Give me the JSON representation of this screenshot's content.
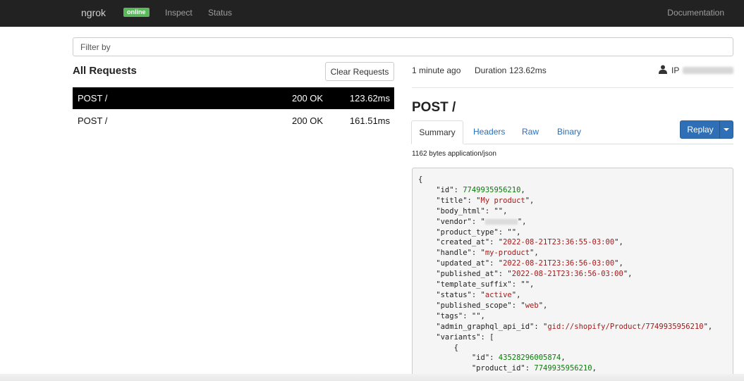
{
  "nav": {
    "brand": "ngrok",
    "badge": "online",
    "inspect": "Inspect",
    "status": "Status",
    "docs": "Documentation"
  },
  "filter": {
    "placeholder": "Filter by"
  },
  "requests": {
    "title": "All Requests",
    "clear_label": "Clear Requests",
    "rows": [
      {
        "method": "POST /",
        "status": "200 OK",
        "duration": "123.62ms",
        "selected": true
      },
      {
        "method": "POST /",
        "status": "200 OK",
        "duration": "161.51ms",
        "selected": false
      }
    ]
  },
  "detail": {
    "time": "1 minute ago",
    "duration_label": "Duration",
    "duration": "123.62ms",
    "ip_label": "IP",
    "title": "POST /",
    "tabs": [
      "Summary",
      "Headers",
      "Raw",
      "Binary"
    ],
    "replay_label": "Replay",
    "size_info": "1162 bytes application/json",
    "json_body": {
      "id": "7749935956210",
      "title": "My product",
      "body_html": "",
      "product_type": "",
      "created_at": "2022-08-21T23:36:55-03:00",
      "handle": "my-product",
      "updated_at": "2022-08-21T23:36:56-03:00",
      "published_at": "2022-08-21T23:36:56-03:00",
      "template_suffix": "",
      "status": "active",
      "published_scope": "web",
      "tags": "",
      "admin_graphql_api_id": "gid://shopify/Product/7749935956210",
      "variant_id": "43528296005874",
      "variant_product_id": "7749935956210"
    }
  },
  "colors": {
    "navbar": "#222222",
    "badge": "#5cb85c",
    "primary": "#2f6fb5",
    "selected_row": "#000000",
    "json_string": "#a11b1b",
    "json_number": "#0c7a0c"
  }
}
